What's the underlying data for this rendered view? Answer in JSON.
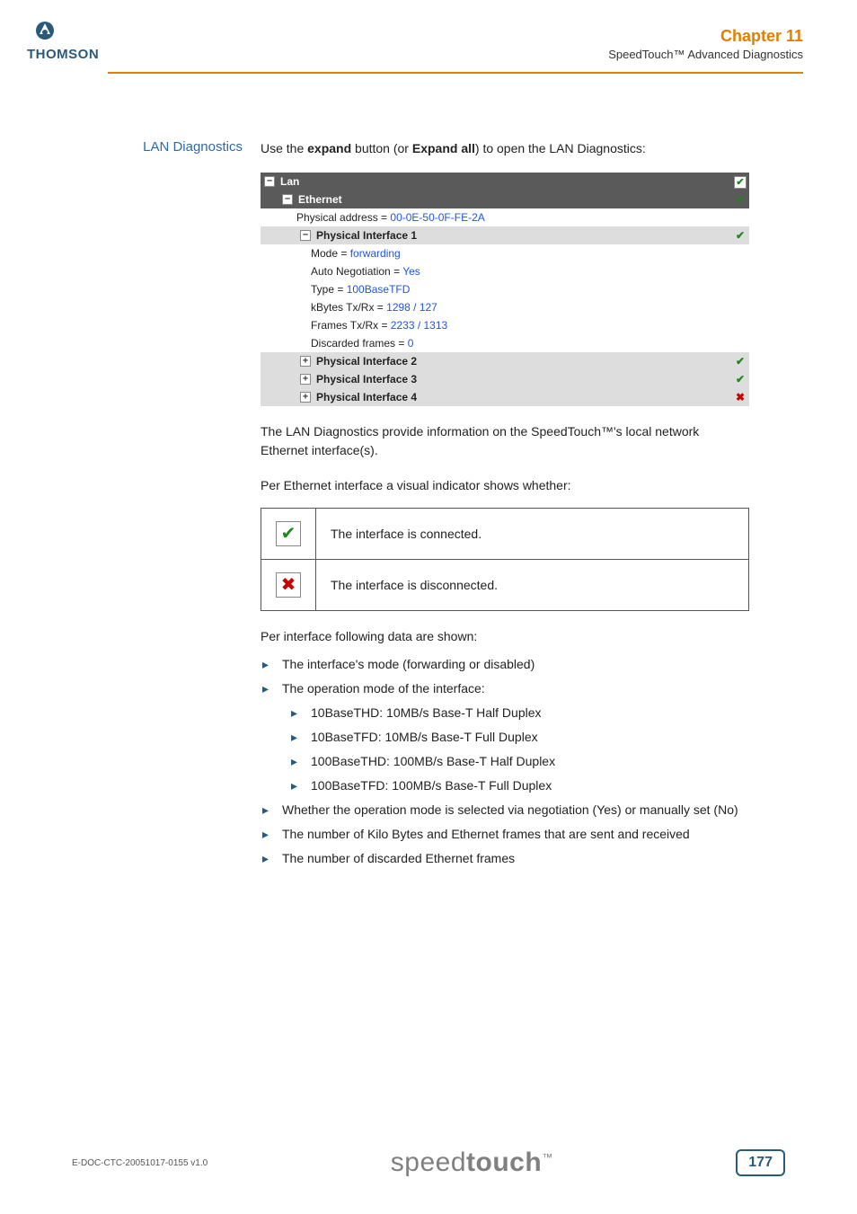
{
  "logo": {
    "brand": "THOMSON"
  },
  "header": {
    "chapter": "Chapter 11",
    "subtitle": "SpeedTouch™ Advanced Diagnostics"
  },
  "section": {
    "label": "LAN Diagnostics",
    "intro_pre": "Use the ",
    "intro_b1": "expand",
    "intro_mid": " button (or ",
    "intro_b2": "Expand all",
    "intro_post": ") to open the LAN Diagnostics:"
  },
  "diag": {
    "lan": "Lan",
    "ethernet": "Ethernet",
    "phys_addr_label": "Physical address = ",
    "phys_addr_val": "00-0E-50-0F-FE-2A",
    "pi1": "Physical Interface 1",
    "mode_label": "Mode = ",
    "mode_val": "forwarding",
    "auto_label": "Auto Negotiation = ",
    "auto_val": "Yes",
    "type_label": "Type = ",
    "type_val": "100BaseTFD",
    "kbytes_label": "kBytes Tx/Rx = ",
    "kbytes_val": "1298 / 127",
    "frames_label": "Frames Tx/Rx = ",
    "frames_val": "2233 / 1313",
    "disc_label": "Discarded frames = ",
    "disc_val": "0",
    "pi2": "Physical Interface 2",
    "pi3": "Physical Interface 3",
    "pi4": "Physical Interface 4"
  },
  "body": {
    "p1": "The LAN Diagnostics provide information on the SpeedTouch™'s local network Ethernet interface(s).",
    "p2": "Per Ethernet interface a visual indicator shows whether:",
    "td_connected": "The interface is connected.",
    "td_disconnected": "The interface is disconnected.",
    "p3": "Per interface following data are shown:",
    "li1": "The interface's mode (forwarding or disabled)",
    "li2": "The operation mode of the interface:",
    "li2a": "10BaseTHD: 10MB/s Base-T Half Duplex",
    "li2b": "10BaseTFD: 10MB/s Base-T Full Duplex",
    "li2c": "100BaseTHD: 100MB/s Base-T Half Duplex",
    "li2d": "100BaseTFD: 100MB/s Base-T Full Duplex",
    "li3": "Whether the operation mode is selected via negotiation (Yes) or manually set (No)",
    "li4": "The number of Kilo Bytes and Ethernet frames that are sent and received",
    "li5": "The number of discarded Ethernet frames"
  },
  "footer": {
    "docref": "E-DOC-CTC-20051017-0155 v1.0",
    "brand_pre": "speed",
    "brand_bold": "touch",
    "brand_tm": "™",
    "page": "177"
  }
}
